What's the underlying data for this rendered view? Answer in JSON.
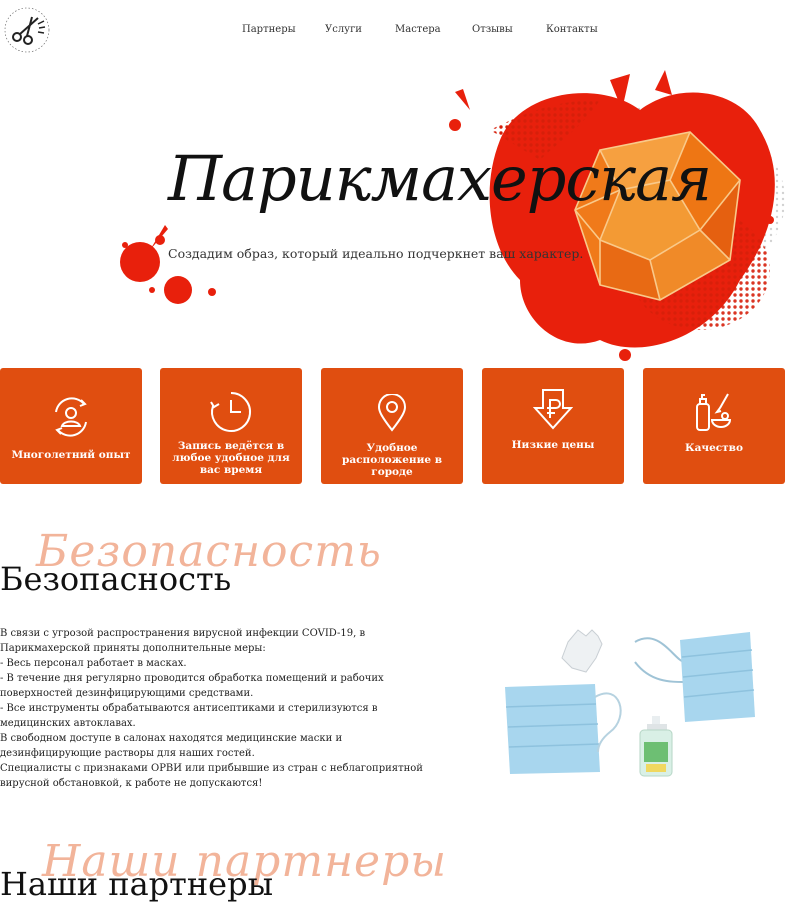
{
  "nav": {
    "items": [
      "Партнеры",
      "Услуги",
      "Мастера",
      "Отзывы",
      "Контакты"
    ]
  },
  "hero": {
    "title": "Парикмахерская",
    "subtitle": "Создадим образ, который идеально подчеркнет ваш характер."
  },
  "features": [
    {
      "label": "Многолетний опыт",
      "icon": "person-cycle-icon"
    },
    {
      "label": "Запись ведётся в любое удобное для вас время",
      "icon": "clock-icon"
    },
    {
      "label": "Удобное расположение в городе",
      "icon": "location-pin-icon"
    },
    {
      "label": "Низкие цены",
      "icon": "ruble-arrow-down-icon"
    },
    {
      "label": "Качество",
      "icon": "cosmetics-icon"
    }
  ],
  "safety": {
    "script": "Безопасность",
    "title": "Безопасность",
    "paragraphs": [
      "В связи с угрозой распространения вирусной инфекции COVID-19, в Парикмахерской приняты дополнительные меры:",
      "- Весь персонал работает в масках.",
      "- В течение дня регулярно проводится обработка помещений и рабочих поверхностей дезинфицирующими средствами.",
      "- Все инструменты обрабатываются антисептиками и стерилизуются в медицинских автоклавах.",
      "В свободном доступе в салонах находятся медицинские маски и дезинфицирующие растворы для наших гостей.",
      "Специалисты с признаками ОРВИ или прибывшие из стран с неблагоприятной вирусной обстановкой, к работе не допускаются!"
    ]
  },
  "partners": {
    "script": "Наши партнеры",
    "title": "Наши партнеры"
  },
  "colors": {
    "accent": "#e04e10",
    "script_heading": "#f2b49a",
    "splash": "#e8200c"
  }
}
